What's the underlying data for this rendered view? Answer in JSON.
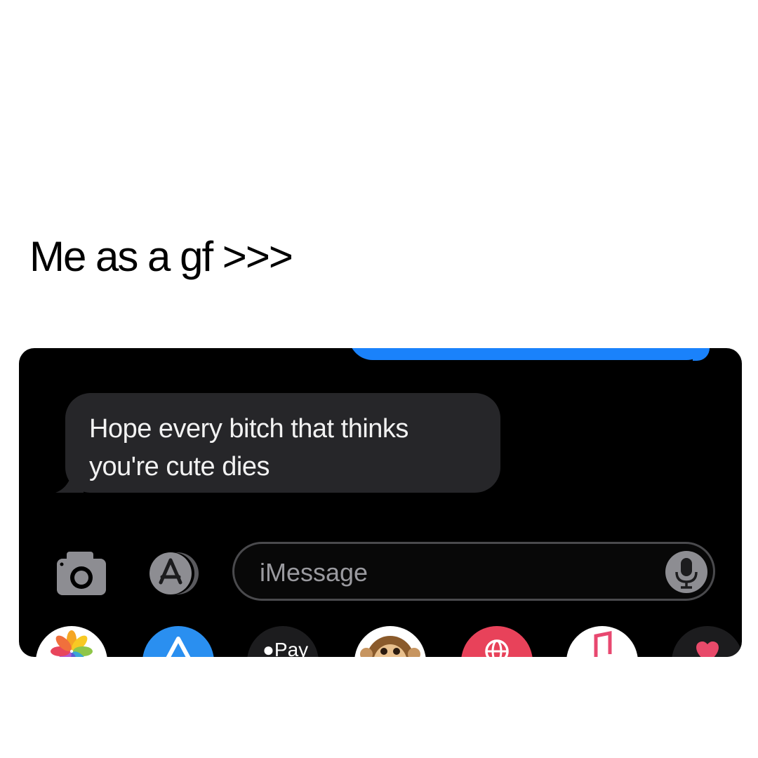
{
  "caption": "Me as a gf >>>",
  "messages": {
    "received": {
      "text": "Hope every bitch that thinks\nyou're cute dies"
    }
  },
  "input": {
    "placeholder": "iMessage"
  },
  "toolbar": {
    "camera_icon": "camera-icon",
    "apps_icon": "app-store-icon",
    "mic_icon": "microphone-icon"
  },
  "app_drawer": [
    {
      "name": "photos-app-icon"
    },
    {
      "name": "app-store-app-icon"
    },
    {
      "name": "apple-pay-app-icon",
      "label": "Pay"
    },
    {
      "name": "animoji-app-icon"
    },
    {
      "name": "web-images-app-icon"
    },
    {
      "name": "music-app-icon"
    },
    {
      "name": "digital-touch-app-icon"
    }
  ],
  "colors": {
    "sent_bubble": "#1a82fb",
    "received_bubble": "#262629",
    "screen_background": "#000000"
  }
}
